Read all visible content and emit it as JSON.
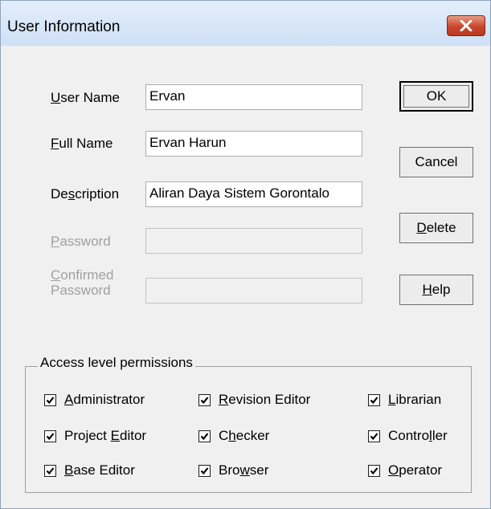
{
  "window": {
    "title": "User Information"
  },
  "fields": [
    {
      "label": "User Name",
      "accel": "U",
      "rest": "ser Name",
      "value": "Ervan",
      "enabled": true
    },
    {
      "label": "Full Name",
      "accel": "F",
      "rest": "ull Name",
      "value": "Ervan Harun",
      "enabled": true
    },
    {
      "label": "Description",
      "pre": "De",
      "accel": "s",
      "rest": "cription",
      "value": "Aliran Daya Sistem Gorontalo",
      "enabled": true
    },
    {
      "label": "Password",
      "accel": "P",
      "rest": "assword",
      "value": "",
      "enabled": false
    },
    {
      "label": "Confirmed Password",
      "accel": "C",
      "rest": "onfirmed",
      "line2": "Password",
      "value": "",
      "enabled": false
    }
  ],
  "buttons": {
    "ok": "OK",
    "cancel": "Cancel",
    "delete": {
      "accel": "D",
      "rest": "elete"
    },
    "help": {
      "accel": "H",
      "rest": "elp"
    }
  },
  "permissions": {
    "title": "Access level permissions",
    "items": [
      {
        "pre": "",
        "accel": "A",
        "rest": "dministrator",
        "checked": true
      },
      {
        "pre": "",
        "accel": "R",
        "rest": "evision Editor",
        "checked": true
      },
      {
        "pre": "",
        "accel": "L",
        "rest": "ibrarian",
        "checked": true
      },
      {
        "pre": "Project ",
        "accel": "E",
        "rest": "ditor",
        "checked": true
      },
      {
        "pre": "C",
        "accel": "h",
        "rest": "ecker",
        "checked": true
      },
      {
        "pre": "Contro",
        "accel": "l",
        "rest": "ler",
        "checked": true
      },
      {
        "pre": "",
        "accel": "B",
        "rest": "ase Editor",
        "checked": true
      },
      {
        "pre": "Bro",
        "accel": "w",
        "rest": "ser",
        "checked": true
      },
      {
        "pre": "",
        "accel": "O",
        "rest": "perator",
        "checked": true
      }
    ]
  },
  "colors": {
    "close_button": "#c9462c",
    "titlebar": "#dbe8f8"
  },
  "icons": {
    "close": "close-icon",
    "check": "checkmark-icon"
  }
}
